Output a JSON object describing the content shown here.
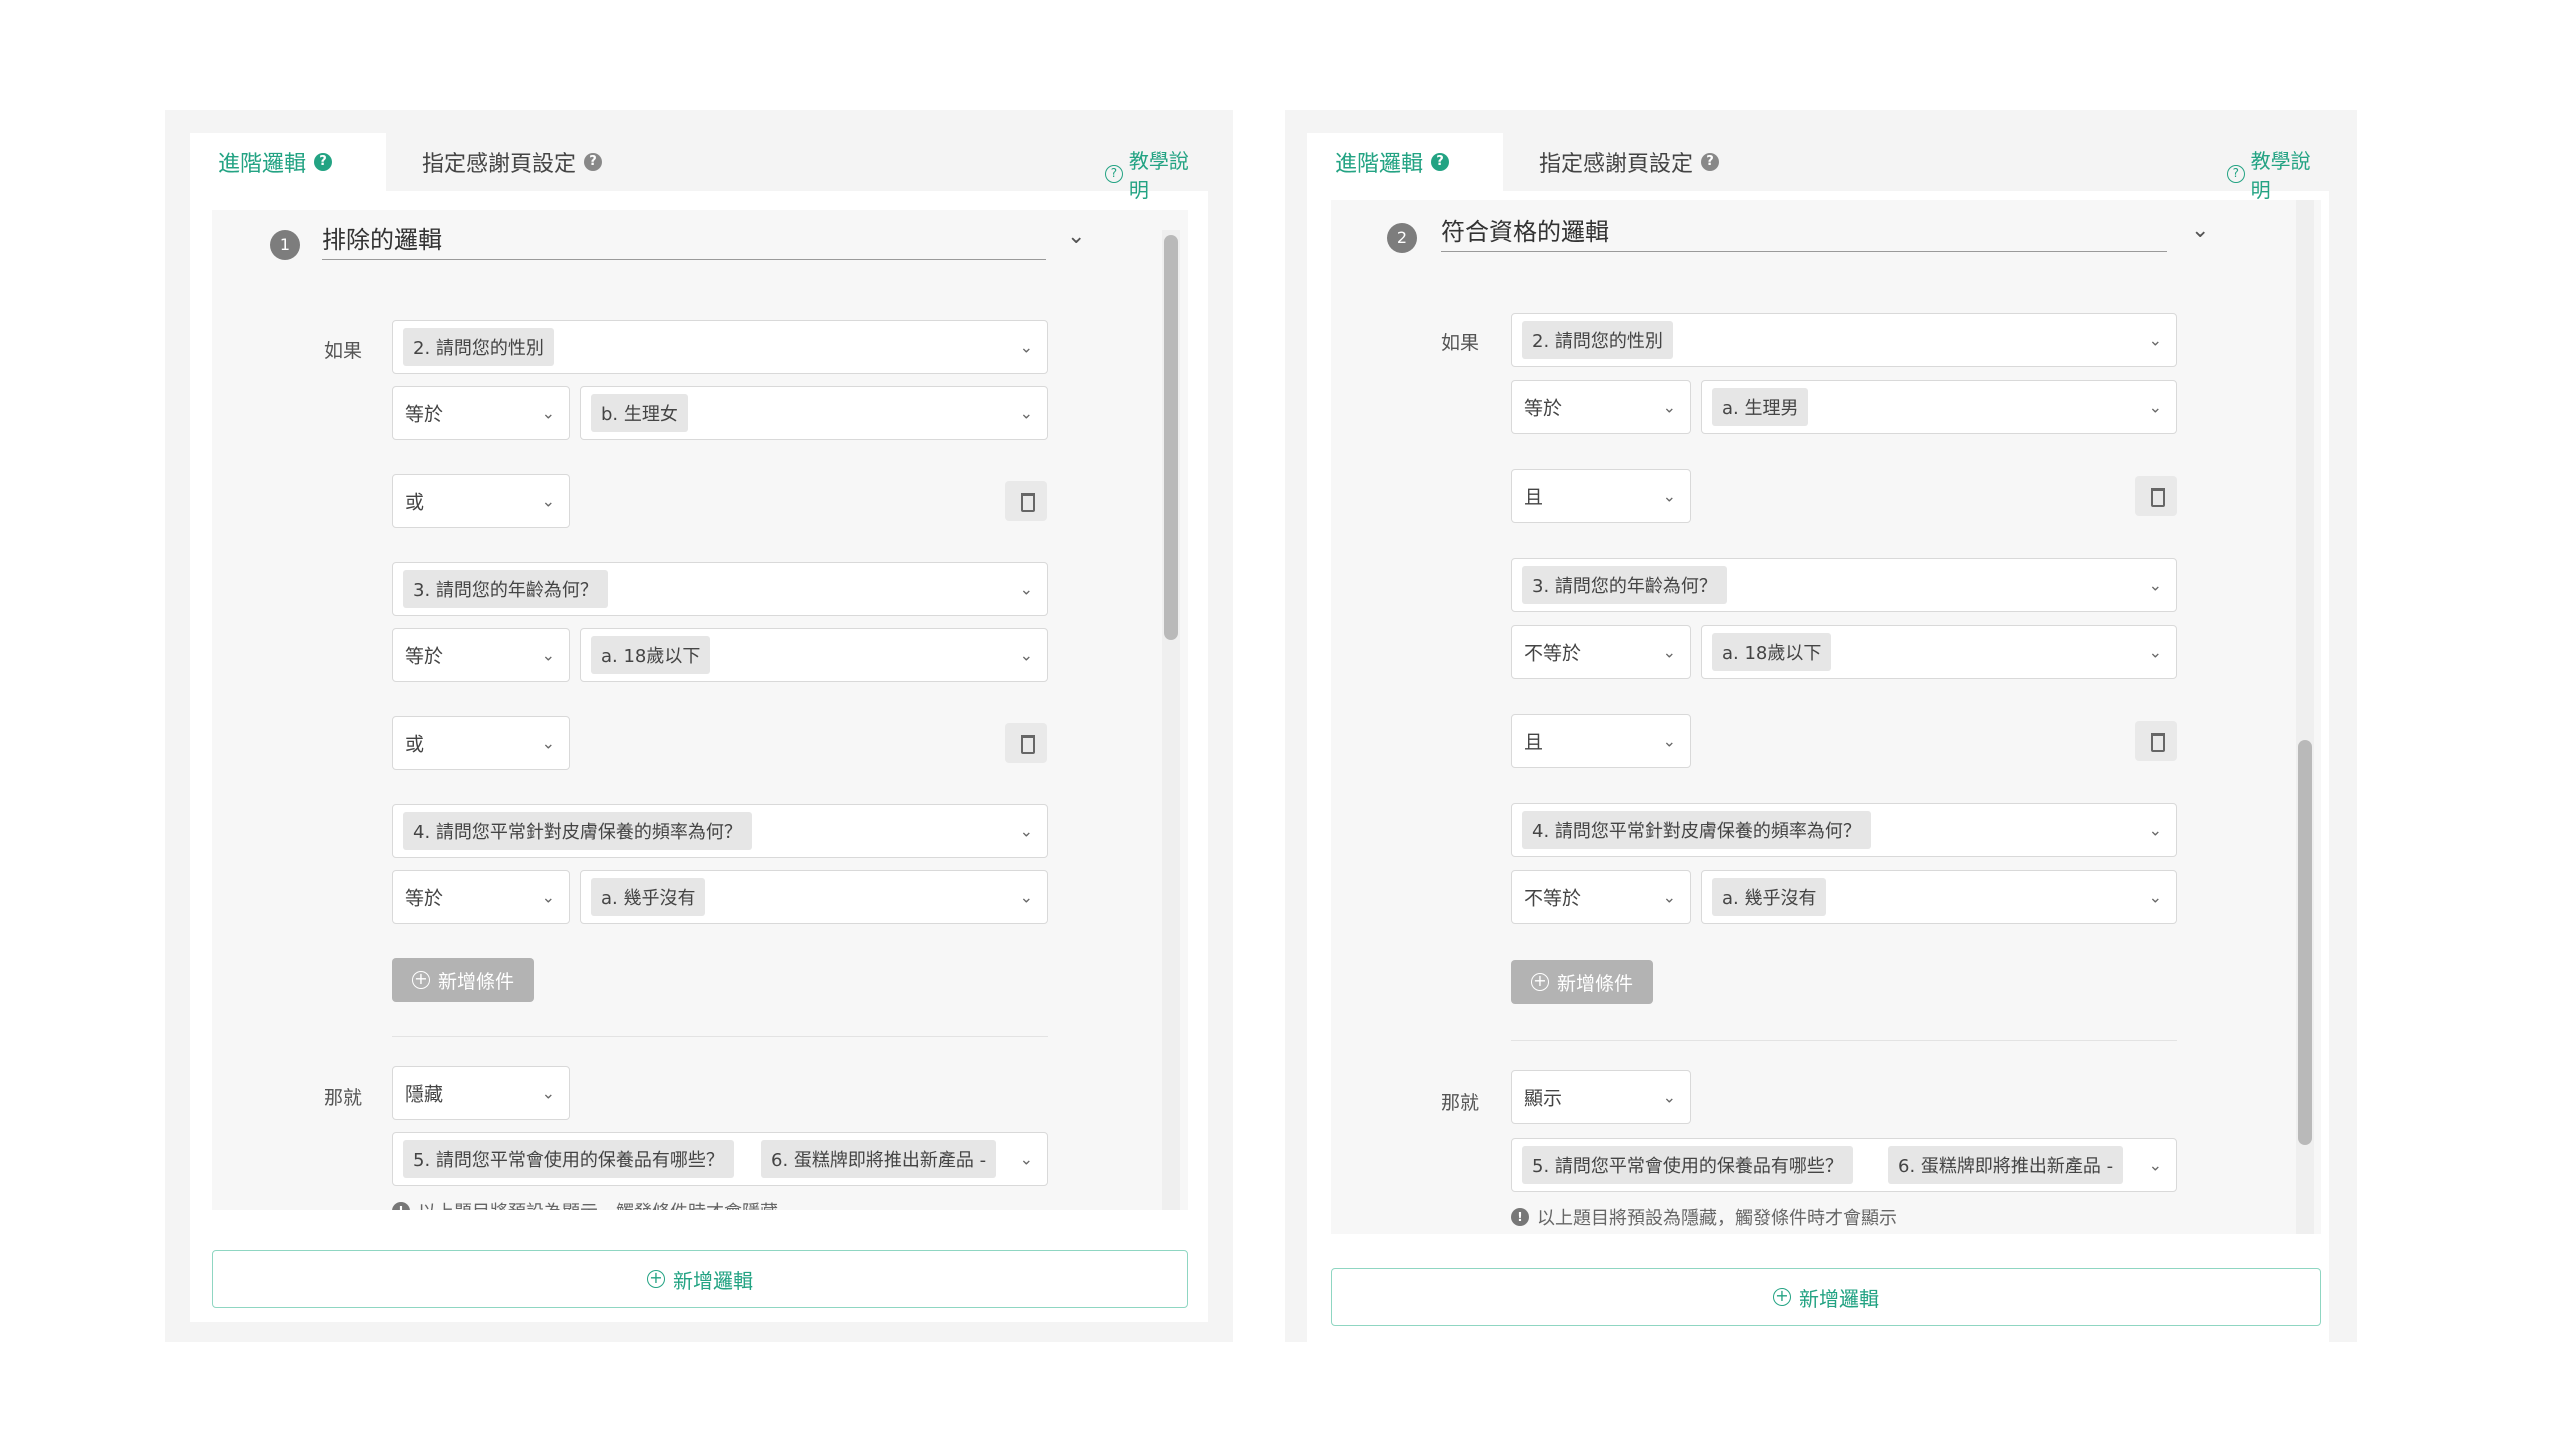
{
  "left": {
    "tabs": [
      {
        "label": "進階邏輯",
        "active": true
      },
      {
        "label": "指定感謝頁設定",
        "active": false
      }
    ],
    "help_label": "教學說明",
    "rule": {
      "number": "1",
      "title": "排除的邏輯",
      "if_label": "如果",
      "then_label": "那就",
      "conditions": [
        {
          "question": "2. 請問您的性別",
          "operator": "等於",
          "answer": "b. 生理女"
        },
        {
          "connector": "或"
        },
        {
          "question": "3. 請問您的年齡為何？",
          "operator": "等於",
          "answer": "a. 18歲以下"
        },
        {
          "connector": "或"
        },
        {
          "question": "4. 請問您平常針對皮膚保養的頻率為何？",
          "operator": "等於",
          "answer": "a. 幾乎沒有"
        }
      ],
      "add_condition_label": "新增條件",
      "action": "隱藏",
      "targets": [
        "5. 請問您平常會使用的保養品有哪些？",
        "6. 蛋糕牌即將推出新產品 -"
      ],
      "note": "以上題目將預設為顯示，觸發條件時才會隱藏"
    },
    "add_logic_label": "新增邏輯"
  },
  "right": {
    "tabs": [
      {
        "label": "進階邏輯",
        "active": true
      },
      {
        "label": "指定感謝頁設定",
        "active": false
      }
    ],
    "help_label": "教學說明",
    "rule": {
      "number": "2",
      "title": "符合資格的邏輯",
      "if_label": "如果",
      "then_label": "那就",
      "conditions": [
        {
          "question": "2. 請問您的性別",
          "operator": "等於",
          "answer": "a. 生理男"
        },
        {
          "connector": "且"
        },
        {
          "question": "3. 請問您的年齡為何？",
          "operator": "不等於",
          "answer": "a. 18歲以下"
        },
        {
          "connector": "且"
        },
        {
          "question": "4. 請問您平常針對皮膚保養的頻率為何？",
          "operator": "不等於",
          "answer": "a. 幾乎沒有"
        }
      ],
      "add_condition_label": "新增條件",
      "action": "顯示",
      "targets": [
        "5. 請問您平常會使用的保養品有哪些？",
        "6. 蛋糕牌即將推出新產品 -"
      ],
      "note": "以上題目將預設為隱藏，觸發條件時才會顯示"
    },
    "add_logic_label": "新增邏輯"
  },
  "colors": {
    "accent": "#23a383",
    "panel_bg": "#f7f7f7",
    "button_disabled": "#b3b3b3"
  },
  "icons": [
    "help-circle-icon",
    "question-icon",
    "chevron-down-icon",
    "trash-icon",
    "plus-circle-icon",
    "info-icon"
  ]
}
